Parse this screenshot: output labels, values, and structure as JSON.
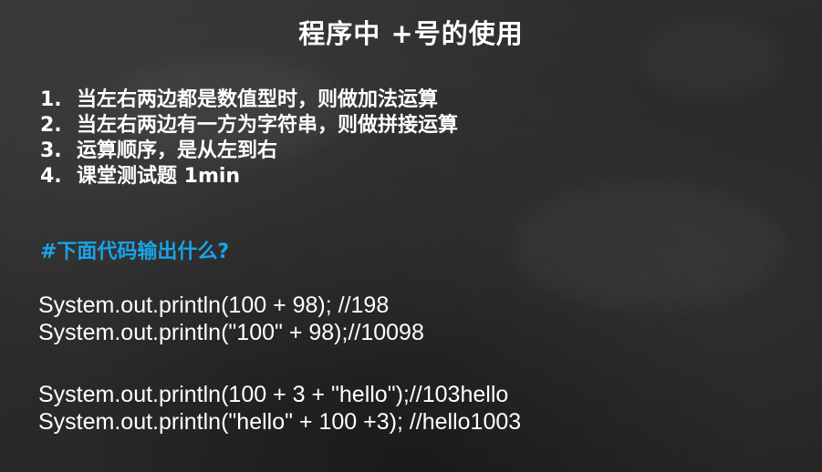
{
  "slide": {
    "title": "程序中 +号的使用",
    "rules": [
      {
        "num": "1.",
        "text": "当左右两边都是数值型时，则做加法运算"
      },
      {
        "num": "2.",
        "text": "当左右两边有一方为字符串，则做拼接运算"
      },
      {
        "num": "3.",
        "text": "运算顺序，是从左到右"
      },
      {
        "num": "4.",
        "text": "课堂测试题 1min"
      }
    ],
    "question": "#下面代码输出什么?",
    "question_color": "#1aa3e8",
    "code_lines": [
      "System.out.println(100 + 98); //198",
      "System.out.println(\"100\" + 98);//10098",
      "System.out.println(100 + 3 + \"hello\");//103hello",
      "System.out.println(\"hello\" + 100 +3); //hello1003"
    ]
  }
}
